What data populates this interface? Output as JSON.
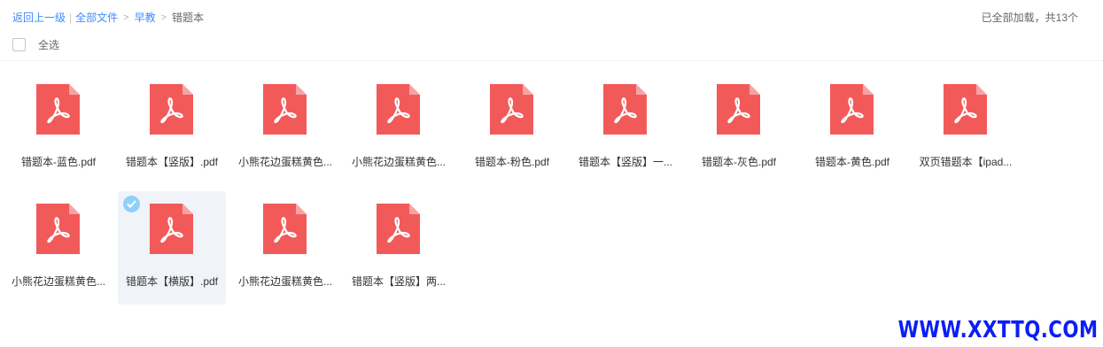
{
  "breadcrumb": {
    "back": "返回上一级",
    "root": "全部文件",
    "parent": "早教",
    "current": "错题本"
  },
  "status_text": "已全部加载，共13个",
  "select_all_label": "全选",
  "files": [
    {
      "name": "错题本-蓝色.pdf",
      "icon": "pdf-icon"
    },
    {
      "name": "错题本【竖版】.pdf",
      "icon": "pdf-icon"
    },
    {
      "name": "小熊花边蛋糕黄色...",
      "icon": "pdf-icon"
    },
    {
      "name": "小熊花边蛋糕黄色...",
      "icon": "pdf-icon"
    },
    {
      "name": "错题本-粉色.pdf",
      "icon": "pdf-icon"
    },
    {
      "name": "错题本【竖版】一...",
      "icon": "pdf-icon"
    },
    {
      "name": "错题本-灰色.pdf",
      "icon": "pdf-icon"
    },
    {
      "name": "错题本-黄色.pdf",
      "icon": "pdf-icon"
    },
    {
      "name": "双页错题本【ipad...",
      "icon": "pdf-icon"
    },
    {
      "name": "小熊花边蛋糕黄色...",
      "icon": "pdf-icon"
    },
    {
      "name": "错题本【横版】.pdf",
      "icon": "pdf-icon",
      "selected": true
    },
    {
      "name": "小熊花边蛋糕黄色...",
      "icon": "pdf-icon"
    },
    {
      "name": "错题本【竖版】两...",
      "icon": "pdf-icon"
    }
  ],
  "watermark": "WWW.XXTTQ.COM",
  "colors": {
    "link": "#3b8cff",
    "pdf_icon": "#f25a5a",
    "selected_bg": "#f0f4f9",
    "check": "#8fd0f8",
    "watermark": "#0a1ef5"
  }
}
